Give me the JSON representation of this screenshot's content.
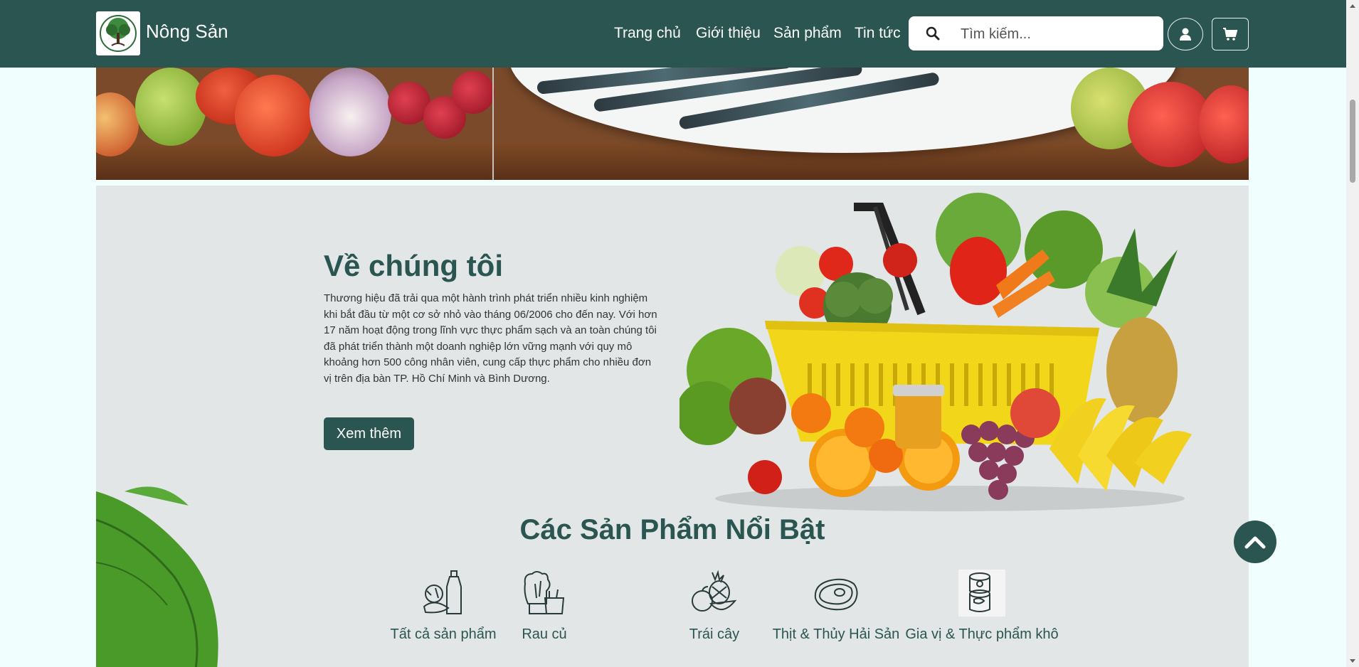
{
  "header": {
    "brand": "Nông Sản",
    "nav": [
      "Trang chủ",
      "Giới thiệu",
      "Sản phẩm",
      "Tin tức"
    ],
    "search_placeholder": "Tìm kiếm...",
    "icons": [
      "search-icon",
      "user-icon",
      "cart-icon"
    ],
    "colors": {
      "header_bg": "#2a5550",
      "accent": "#2a5550"
    }
  },
  "about": {
    "title": "Về chúng tôi",
    "text": "Thương hiệu đã trải qua một hành trình phát triển nhiều kinh nghiệm khi bắt đầu từ một cơ sở nhỏ vào tháng 06/2006 cho đến nay. Với hơn 17 năm hoạt động trong lĩnh vực thực phẩm sạch và an toàn chúng tôi đã phát triển thành một doanh nghiệp lớn vững mạnh với quy mô khoảng hơn 500 công nhân viên, cung cấp thực phẩm cho nhiều đơn vị trên địa bàn TP. Hồ Chí Minh và Bình Dương.",
    "button": "Xem thêm"
  },
  "featured": {
    "title": "Các Sản Phẩm Nổi Bật",
    "categories": [
      {
        "label": "Tất cả sản phẩm",
        "icon": "groceries-icon"
      },
      {
        "label": "Rau củ",
        "icon": "vegetables-icon"
      },
      {
        "label": "Trái cây",
        "icon": "fruits-icon"
      },
      {
        "label": "Thịt & Thủy Hải Sản",
        "icon": "meat-icon"
      },
      {
        "label": "Gia vị & Thực phẩm khô",
        "icon": "canned-food-icon"
      }
    ]
  }
}
